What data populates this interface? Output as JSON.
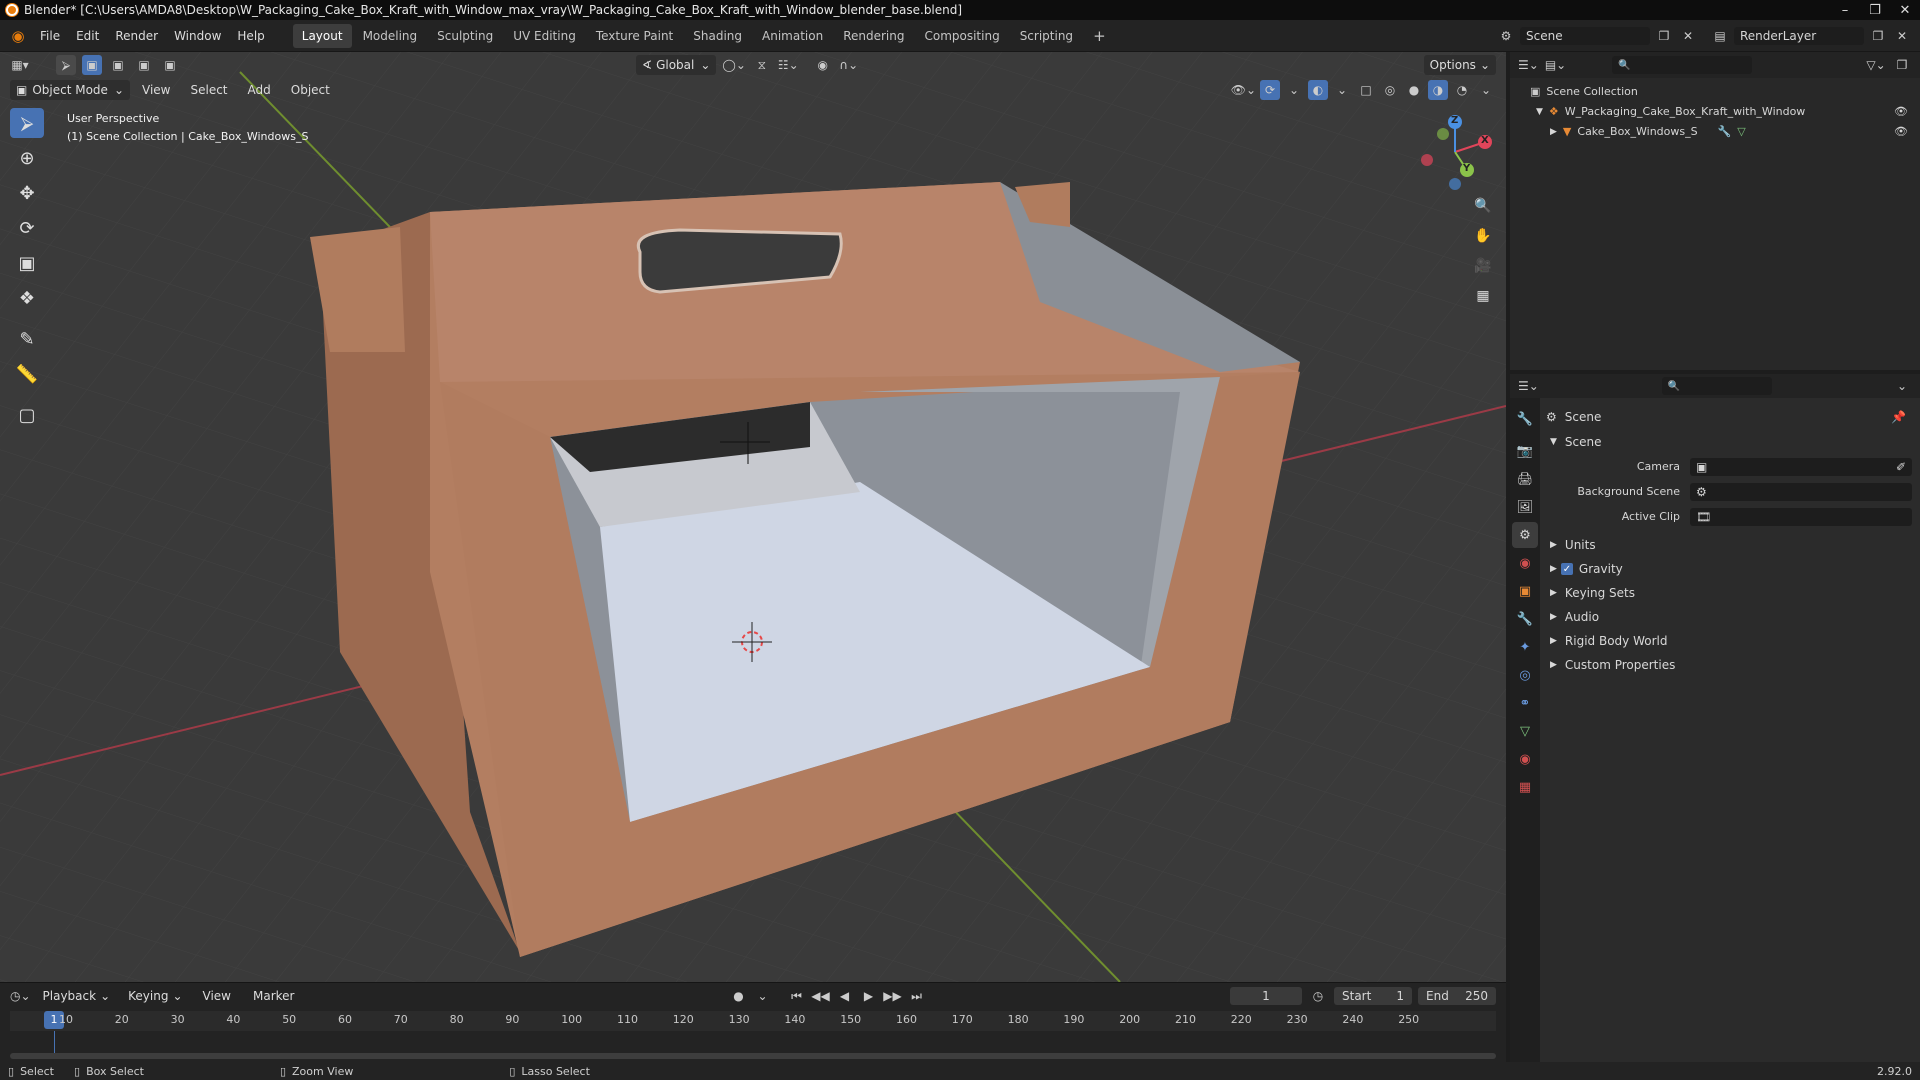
{
  "titlebar": {
    "title": "Blender* [C:\\Users\\AMDA8\\Desktop\\W_Packaging_Cake_Box_Kraft_with_Window_max_vray\\W_Packaging_Cake_Box_Kraft_with_Window_blender_base.blend]"
  },
  "menu": [
    "File",
    "Edit",
    "Render",
    "Window",
    "Help"
  ],
  "workspaces": [
    "Layout",
    "Modeling",
    "Sculpting",
    "UV Editing",
    "Texture Paint",
    "Shading",
    "Animation",
    "Rendering",
    "Compositing",
    "Scripting"
  ],
  "scene": {
    "label": "Scene",
    "render_layer": "RenderLayer"
  },
  "viewport_header": {
    "transform_orientation": "Global",
    "options": "Options",
    "mode": "Object Mode",
    "menus": [
      "View",
      "Select",
      "Add",
      "Object"
    ]
  },
  "viewport_overlay": {
    "line1": "User Perspective",
    "line2": "(1) Scene Collection | Cake_Box_Windows_S"
  },
  "gizmo": {
    "x": "X",
    "y": "Y",
    "z": "Z"
  },
  "outliner": {
    "root": "Scene Collection",
    "items": [
      {
        "label": "W_Packaging_Cake_Box_Kraft_with_Window"
      },
      {
        "label": "Cake_Box_Windows_S"
      }
    ]
  },
  "properties": {
    "header": "Scene",
    "panel": "Scene",
    "fields": [
      {
        "label": "Camera"
      },
      {
        "label": "Background Scene"
      },
      {
        "label": "Active Clip"
      }
    ],
    "sections": [
      "Units",
      "Gravity",
      "Keying Sets",
      "Audio",
      "Rigid Body World",
      "Custom Properties"
    ]
  },
  "timeline": {
    "menus": [
      "Playback",
      "Keying",
      "View",
      "Marker"
    ],
    "current_frame": "1",
    "start_label": "Start",
    "start": "1",
    "end_label": "End",
    "end": "250",
    "ticks": [
      "10",
      "20",
      "30",
      "40",
      "50",
      "60",
      "70",
      "80",
      "90",
      "100",
      "110",
      "120",
      "130",
      "140",
      "150",
      "160",
      "170",
      "180",
      "190",
      "200",
      "210",
      "220",
      "230",
      "240",
      "250"
    ],
    "playhead": "1"
  },
  "statusbar": {
    "select": "Select",
    "box_select": "Box Select",
    "zoom_view": "Zoom View",
    "lasso_select": "Lasso Select",
    "version": "2.92.0"
  },
  "colors": {
    "accent": "#4772b3",
    "kraft": "#b07c5e",
    "x_axis": "#e0455a",
    "y_axis": "#8bc34a",
    "z_axis": "#4a90e2"
  }
}
